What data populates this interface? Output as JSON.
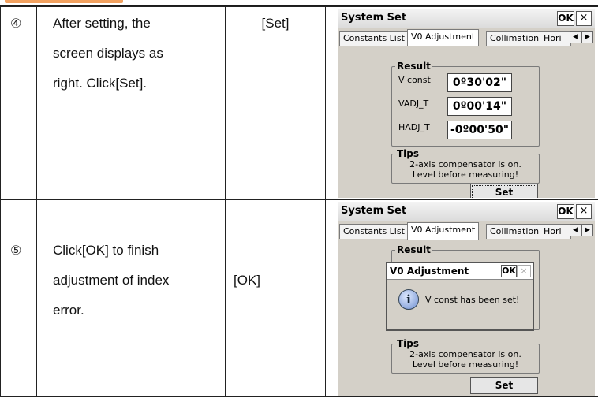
{
  "steps": [
    {
      "number": "④",
      "description_lines": [
        "After setting, the",
        "screen displays as",
        "right. Click[Set]."
      ],
      "key": "[Set]",
      "screen": {
        "title": "System Set",
        "ok": "OK",
        "close": "×",
        "tabs": [
          "Constants List",
          "V0 Adjustment",
          "Collimation",
          "Hori"
        ],
        "active_tab": "V0 Adjustment",
        "result_label": "Result",
        "rows": [
          {
            "label": "V const",
            "value": "0º30'02\""
          },
          {
            "label": "VADJ_T",
            "value": "0º00'14\""
          },
          {
            "label": "HADJ_T",
            "value": "-0º00'50\""
          }
        ],
        "tips_label": "Tips",
        "tips": [
          "2-axis compensator is on.",
          "Level before measuring!"
        ],
        "set_label": "Set"
      }
    },
    {
      "number": "⑤",
      "description_lines": [
        "Click[OK] to finish",
        "adjustment of index",
        "error."
      ],
      "key": "[OK]",
      "screen": {
        "title": "System Set",
        "ok": "OK",
        "close": "×",
        "tabs": [
          "Constants List",
          "V0 Adjustment",
          "Collimation",
          "Hori"
        ],
        "active_tab": "V0 Adjustment",
        "result_label": "Result",
        "dialog": {
          "title": "V0 Adjustment",
          "ok": "OK",
          "close": "×",
          "icon": "info-icon",
          "message": "V const has been set!"
        },
        "tips_label": "Tips",
        "tips": [
          "2-axis compensator is on.",
          "Level before measuring!"
        ],
        "set_label": "Set"
      }
    }
  ],
  "colors": {
    "header_accent": "#f2a15f",
    "screen_bg": "#d4d0c8"
  }
}
